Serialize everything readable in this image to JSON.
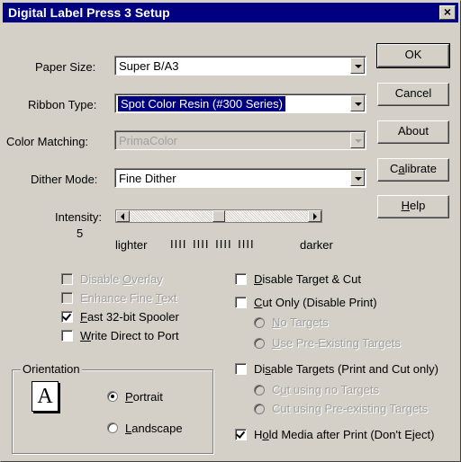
{
  "window": {
    "title": "Digital Label Press 3 Setup",
    "close_glyph": "×"
  },
  "fields": {
    "paper_size": {
      "label": "Paper Size:",
      "value": "Super B/A3"
    },
    "ribbon_type": {
      "label": "Ribbon Type:",
      "value": "Spot Color Resin (#300 Series)"
    },
    "color_matching": {
      "label": "Color Matching:",
      "value": "PrimaColor"
    },
    "dither_mode": {
      "label": "Dither Mode:",
      "value": "Fine Dither"
    }
  },
  "buttons": {
    "ok": "OK",
    "cancel": "Cancel",
    "about": "About",
    "calibrate": {
      "pre": "C",
      "accel": "a",
      "post": "librate"
    },
    "help": {
      "pre": "",
      "accel": "H",
      "post": "elp"
    }
  },
  "intensity": {
    "label": "Intensity:",
    "value": "5",
    "lighter": "lighter",
    "darker": "darker",
    "ticks": "IIII  IIII  IIII  IIII",
    "level": 5,
    "min": 1,
    "max": 9
  },
  "left_options": {
    "disable_overlay": {
      "pre": "Disable ",
      "accel": "O",
      "post": "verlay",
      "checked": false,
      "enabled": false
    },
    "enhance_fine_text": {
      "pre": "Enhance Fine ",
      "accel": "T",
      "post": "ext",
      "checked": false,
      "enabled": false
    },
    "fast_spooler": {
      "pre": "",
      "accel": "F",
      "post": "ast 32-bit Spooler",
      "checked": true,
      "enabled": true
    },
    "write_direct": {
      "pre": "",
      "accel": "W",
      "post": "rite Direct to Port",
      "checked": false,
      "enabled": true
    }
  },
  "orientation": {
    "title": "Orientation",
    "icon_letter": "A",
    "portrait": {
      "pre": "",
      "accel": "P",
      "post": "ortrait",
      "selected": true
    },
    "landscape": {
      "pre": "",
      "accel": "L",
      "post": "andscape",
      "selected": false
    }
  },
  "right_options": {
    "disable_target_cut": {
      "pre": "",
      "accel": "D",
      "post": "isable Target & Cut",
      "checked": false
    },
    "cut_only": {
      "pre": "",
      "accel": "C",
      "post": "ut Only (Disable Print)",
      "checked": false
    },
    "no_targets": {
      "pre": "",
      "accel": "N",
      "post": "o Targets"
    },
    "use_preexisting": {
      "pre": "",
      "accel": "U",
      "post": "se Pre-Existing Targets"
    },
    "disable_targets": {
      "pre": "Di",
      "accel": "s",
      "post": "able Targets (Print and Cut only)",
      "checked": false
    },
    "cut_no_targets": {
      "pre": "C",
      "accel": "u",
      "post": "t using no Targets"
    },
    "cut_preexisting": {
      "pre": "Cut using Pre-existing Targets",
      "accel": "",
      "post": ""
    },
    "hold_media": {
      "pre": "H",
      "accel": "o",
      "post": "ld Media after Print (Don't Eject)",
      "checked": true
    }
  }
}
